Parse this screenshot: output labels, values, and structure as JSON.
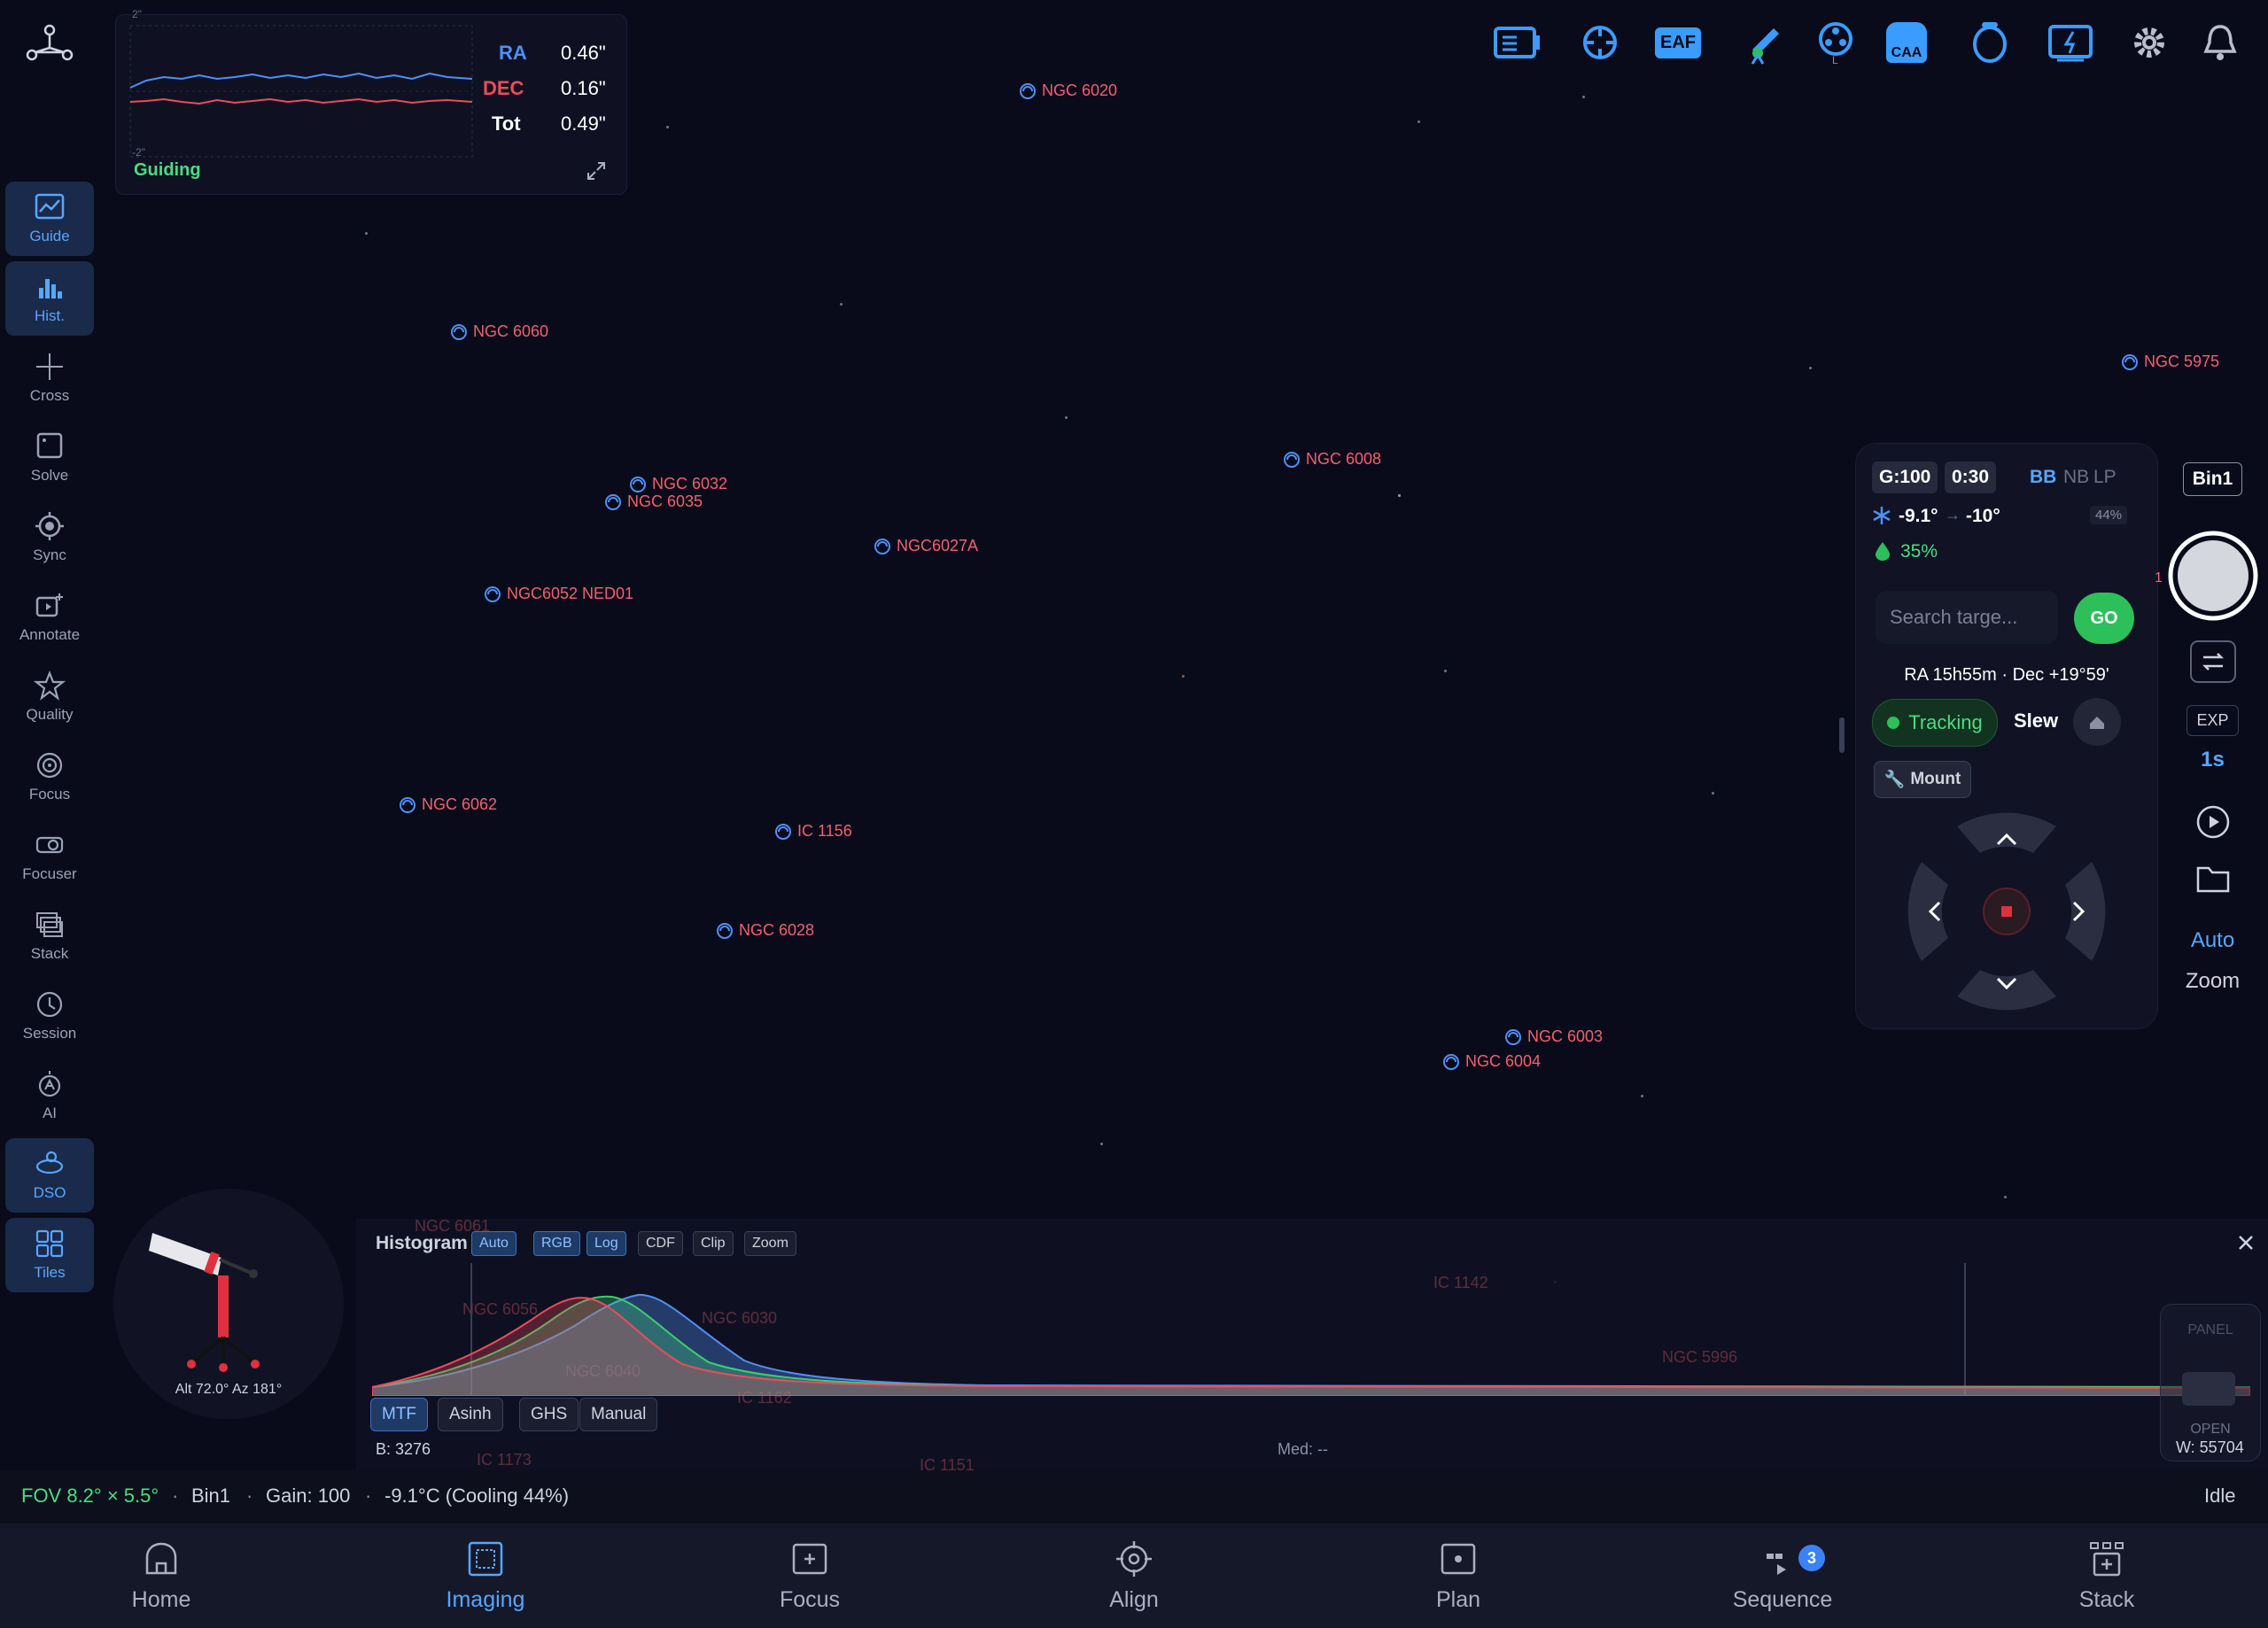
{
  "colors": {
    "accent": "#58a6ff",
    "ra": "#4f8ff7",
    "dec": "#f04a5a",
    "guiding": "#4ade80",
    "dso_label": "#f06070",
    "go": "#2dbf5a"
  },
  "guide": {
    "ra_label": "RA",
    "ra_value": "0.46\"",
    "dec_label": "DEC",
    "dec_value": "0.16\"",
    "tot_label": "Tot",
    "tot_value": "0.49\"",
    "scale_top": "2\"",
    "scale_bottom": "-2\"",
    "status": "Guiding"
  },
  "toolbar": {
    "icons": [
      "camera-icon",
      "focuser-icon",
      "eaf-icon",
      "telescope-icon",
      "filter-wheel-icon",
      "caa-icon",
      "ring-icon",
      "power-icon",
      "settings-icon",
      "bell-icon"
    ],
    "eaf_label": "EAF",
    "caa_label": "CAA"
  },
  "sidebar": {
    "items": [
      {
        "label": "Guide",
        "icon": "guide-icon",
        "active": true
      },
      {
        "label": "Hist.",
        "icon": "histogram-icon",
        "active": true
      },
      {
        "label": "Cross",
        "icon": "crosshair-icon"
      },
      {
        "label": "Solve",
        "icon": "solve-icon"
      },
      {
        "label": "Sync",
        "icon": "sync-icon"
      },
      {
        "label": "Annotate",
        "icon": "annotate-icon"
      },
      {
        "label": "Quality",
        "icon": "star-icon"
      },
      {
        "label": "Focus",
        "icon": "focus-icon"
      },
      {
        "label": "Focuser",
        "icon": "focuser-icon"
      },
      {
        "label": "Stack",
        "icon": "stack-icon"
      },
      {
        "label": "Session",
        "icon": "clock-icon"
      },
      {
        "label": "AI",
        "icon": "ai-icon"
      },
      {
        "label": "DSO",
        "icon": "dso-icon",
        "active": true
      },
      {
        "label": "Tiles",
        "icon": "tiles-icon",
        "active": true
      }
    ]
  },
  "objects": [
    {
      "name": "NGC 6020"
    },
    {
      "name": "NGC 5975"
    },
    {
      "name": "NGC 6060"
    },
    {
      "name": "NGC 6008"
    },
    {
      "name": "NGC 6032"
    },
    {
      "name": "NGC 6035"
    },
    {
      "name": "NGC6027A"
    },
    {
      "name": "NGC6052 NED01"
    },
    {
      "name": "NGC 6062"
    },
    {
      "name": "IC 1156"
    },
    {
      "name": "NGC 6028"
    },
    {
      "name": "NGC 6003"
    },
    {
      "name": "NGC 6004"
    }
  ],
  "hist_objects": [
    {
      "name": "IC 1142"
    },
    {
      "name": "NGC 5996"
    },
    {
      "name": "NGC 6056"
    },
    {
      "name": "NGC 6030"
    },
    {
      "name": "IC 1162"
    },
    {
      "name": "IC 1173"
    },
    {
      "name": "IC 1151"
    },
    {
      "name": "NGC 6061"
    },
    {
      "name": "NGC 6040"
    }
  ],
  "control": {
    "gain": "G:100",
    "exposure": "0:30",
    "filters": [
      "BB",
      "NB",
      "LP"
    ],
    "temp_current": "-9.1°",
    "temp_target": "-10°",
    "cooling_pct": "44%",
    "humidity": "35%",
    "search_placeholder": "Search targe...",
    "go_label": "GO",
    "coords": "RA 15h55m · Dec +19°59'",
    "tracking_label": "Tracking",
    "slew_label": "Slew",
    "mount_label": "Mount"
  },
  "right": {
    "bin": "Bin1",
    "exp_label": "EXP",
    "exp_value": "1s",
    "auto_label": "Auto",
    "zoom_label": "Zoom",
    "edge_text": "1"
  },
  "mount": {
    "altaz": "Alt 72.0° Az 181°"
  },
  "histogram": {
    "title": "Histogram",
    "toggles": [
      {
        "label": "Auto",
        "on": true
      },
      {
        "label": "RGB",
        "on": true
      },
      {
        "label": "Log",
        "on": true
      },
      {
        "label": "CDF",
        "on": false
      },
      {
        "label": "Clip",
        "on": false
      },
      {
        "label": "Zoom",
        "on": false
      }
    ],
    "stretch": [
      {
        "label": "MTF",
        "on": true
      },
      {
        "label": "Asinh",
        "on": false
      },
      {
        "label": "GHS",
        "on": false
      },
      {
        "label": "Manual",
        "on": false
      }
    ],
    "black": "B: 3276",
    "median": "Med: --",
    "white": "W: 55704",
    "panel_label": "PANEL",
    "open_label": "OPEN"
  },
  "status": {
    "fov": "FOV 8.2° × 5.5°",
    "bin": "Bin1",
    "gain": "Gain: 100",
    "temp": "-9.1°C (Cooling 44%)",
    "state": "Idle",
    "sep": "·"
  },
  "nav": {
    "items": [
      {
        "label": "Home",
        "icon": "home-icon"
      },
      {
        "label": "Imaging",
        "icon": "imaging-icon",
        "active": true
      },
      {
        "label": "Focus",
        "icon": "focus-icon"
      },
      {
        "label": "Align",
        "icon": "align-icon"
      },
      {
        "label": "Plan",
        "icon": "plan-icon"
      },
      {
        "label": "Sequence",
        "icon": "sequence-icon",
        "badge": "3"
      },
      {
        "label": "Stack",
        "icon": "stack-icon"
      }
    ]
  }
}
